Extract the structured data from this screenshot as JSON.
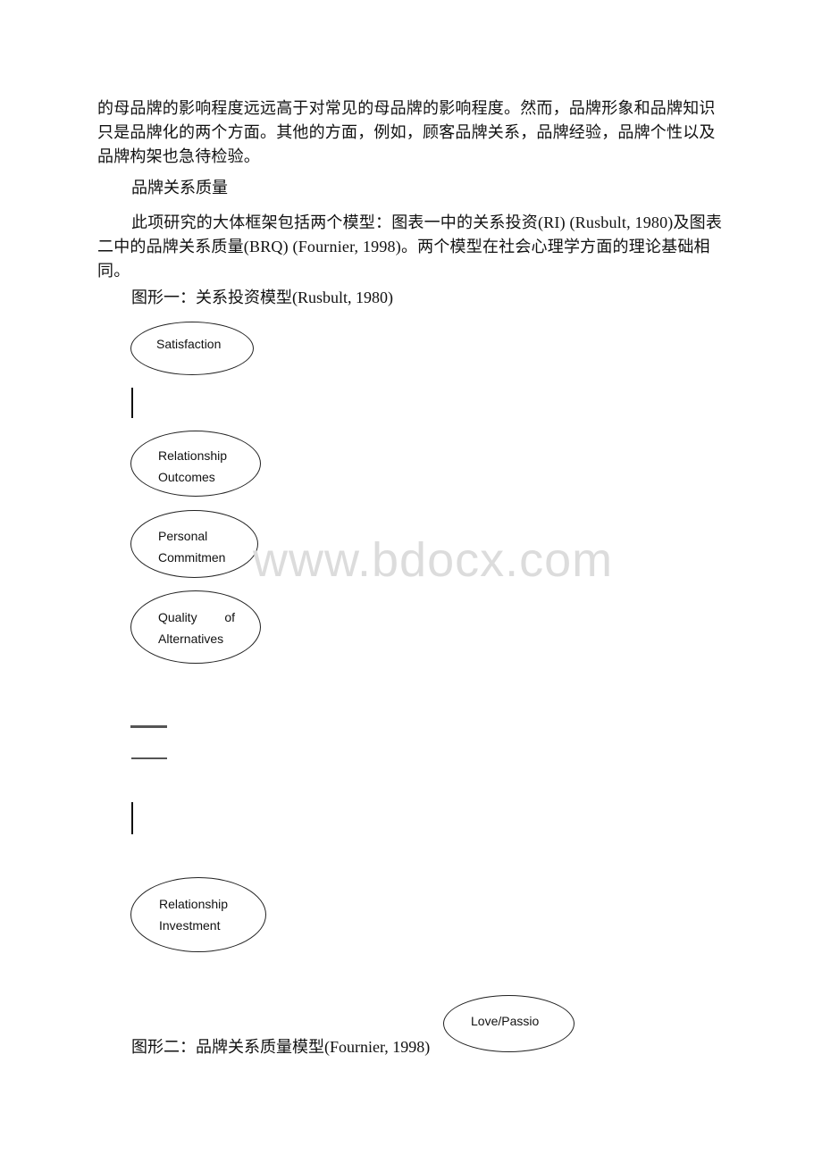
{
  "document": {
    "paragraph_1": "的母品牌的影响程度远远高于对常见的母品牌的影响程度。然而，品牌形象和品牌知识只是品牌化的两个方面。其他的方面，例如，顾客品牌关系，品牌经验，品牌个性以及品牌构架也急待检验。",
    "section_heading": "品牌关系质量",
    "paragraph_2": "此项研究的大体框架包括两个模型：图表一中的关系投资(RI) (Rusbult, 1980)及图表二中的品牌关系质量(BRQ) (Fournier, 1998)。两个模型在社会心理学方面的理论基础相同。",
    "figure_1_caption": "图形一：关系投资模型(Rusbult, 1980)",
    "figure_2_caption": "图形二：品牌关系质量模型(Fournier, 1998)"
  },
  "figure_1": {
    "nodes": [
      {
        "id": "satisfaction",
        "lines": [
          "Satisfaction"
        ]
      },
      {
        "id": "relationship-outcomes",
        "lines": [
          "Relationship",
          "Outcomes"
        ]
      },
      {
        "id": "personal-commitment",
        "lines": [
          "Personal",
          "Commitmen"
        ]
      },
      {
        "id": "quality-of-alternatives",
        "lines": [
          "Quality",
          "of",
          "Alternatives"
        ]
      },
      {
        "id": "relationship-investment",
        "lines": [
          "Relationship",
          "Investment"
        ]
      }
    ]
  },
  "figure_2": {
    "nodes": [
      {
        "id": "love-passion",
        "lines": [
          "Love/Passio"
        ]
      }
    ]
  },
  "watermark": "www.bdocx.com"
}
